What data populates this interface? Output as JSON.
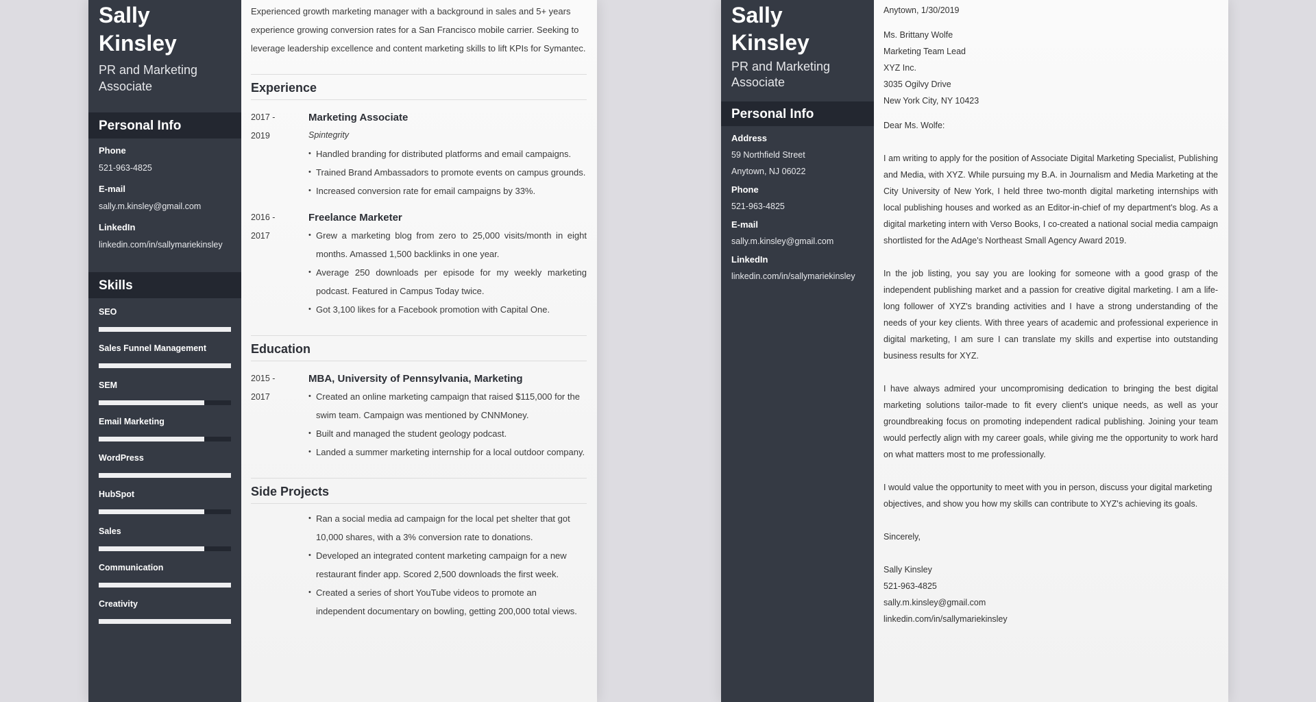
{
  "resume": {
    "sidebar": {
      "name_first": "Sally",
      "name_last": "Kinsley",
      "title": "PR and Marketing Associate",
      "personal_info_heading": "Personal Info",
      "personal_info": [
        {
          "label": "Phone",
          "value": "521-963-4825"
        },
        {
          "label": "E-mail",
          "value": "sally.m.kinsley@gmail.com"
        },
        {
          "label": "LinkedIn",
          "value": "linkedin.com/in/sallymariekinsley"
        }
      ],
      "skills_heading": "Skills",
      "skills": [
        {
          "name": "SEO",
          "level": 1.0
        },
        {
          "name": "Sales Funnel Management",
          "level": 1.0
        },
        {
          "name": "SEM",
          "level": 0.8
        },
        {
          "name": "Email Marketing",
          "level": 0.8
        },
        {
          "name": "WordPress",
          "level": 1.0
        },
        {
          "name": "HubSpot",
          "level": 0.8
        },
        {
          "name": "Sales",
          "level": 0.8
        },
        {
          "name": "Communication",
          "level": 1.0
        },
        {
          "name": "Creativity",
          "level": 1.0
        }
      ]
    },
    "summary": "Experienced growth marketing manager with a background in sales and 5+ years experience growing conversion rates for a San Francisco mobile carrier. Seeking to leverage leadership excellence and content marketing skills to lift KPIs for Symantec.",
    "experience": {
      "heading": "Experience",
      "entries": [
        {
          "date_start": "2017 -",
          "date_end": "2019",
          "title": "Marketing Associate",
          "company": "Spintegrity",
          "bullets": [
            "Handled branding for distributed platforms and email campaigns.",
            "Trained Brand Ambassadors to promote events on campus grounds.",
            "Increased conversion rate for email campaigns by 33%."
          ]
        },
        {
          "date_start": "2016 -",
          "date_end": "2017",
          "title": "Freelance Marketer",
          "bullets": [
            "Grew a marketing blog from zero to 25,000 visits/month in eight months. Amassed 1,500 backlinks in one year.",
            "Average 250 downloads per episode for my weekly marketing podcast. Featured in Campus Today twice.",
            "Got 3,100 likes for a Facebook promotion with Capital One."
          ]
        }
      ]
    },
    "education": {
      "heading": "Education",
      "entries": [
        {
          "date_start": "2015 -",
          "date_end": "2017",
          "title": "MBA, University of Pennsylvania, Marketing",
          "bullets": [
            "Created an online marketing campaign that raised $115,000 for the swim team. Campaign was mentioned by CNNMoney.",
            "Built and managed the student geology podcast.",
            "Landed a summer marketing internship for a local outdoor company."
          ]
        }
      ]
    },
    "side_projects": {
      "heading": "Side Projects",
      "bullets": [
        "Ran a social media ad campaign for the local pet shelter that got 10,000 shares, with a 3% conversion rate to donations.",
        "Developed an integrated content marketing campaign for a new restaurant finder app. Scored 2,500 downloads the first week.",
        "Created a series of short YouTube videos to promote an independent documentary on bowling, getting 200,000 total views."
      ]
    }
  },
  "cover_letter": {
    "sidebar": {
      "name_first": "Sally",
      "name_last": "Kinsley",
      "title": "PR and Marketing Associate",
      "personal_info_heading": "Personal Info",
      "personal_info": [
        {
          "label": "Address",
          "values": [
            "59 Northfield Street",
            "Anytown, NJ 06022"
          ]
        },
        {
          "label": "Phone",
          "values": [
            "521-963-4825"
          ]
        },
        {
          "label": "E-mail",
          "values": [
            "sally.m.kinsley@gmail.com"
          ]
        },
        {
          "label": "LinkedIn",
          "values": [
            "linkedin.com/in/sallymariekinsley"
          ]
        }
      ]
    },
    "date_line": "Anytown, 1/30/2019",
    "recipient": [
      "Ms. Brittany Wolfe",
      "Marketing Team Lead",
      "XYZ Inc.",
      "3035 Ogilvy Drive",
      "New York City, NY 10423"
    ],
    "salutation": "Dear Ms. Wolfe:",
    "paragraphs": [
      "I am writing to apply for the position of Associate Digital Marketing Specialist, Publishing and Media, with XYZ. While pursuing my B.A. in Journalism and Media Marketing at the City University of New York, I held three two-month digital marketing internships with local publishing houses and worked as an Editor-in-chief of my department's blog. As a digital marketing intern with Verso Books, I co-created a national social media campaign shortlisted for the AdAge's Northeast Small Agency Award 2019.",
      "In the job listing, you say you are looking for someone with a good grasp of the independent publishing market and a passion for creative digital marketing. I am a life-long follower of XYZ's branding activities and I have a strong understanding of the needs of your key clients. With three years of academic and professional experience in digital marketing, I am sure I can translate my skills and expertise into outstanding business results for XYZ.",
      "I have always admired your uncompromising dedication to bringing the best digital marketing solutions tailor-made to fit every client's unique needs, as well as your groundbreaking focus on promoting independent radical publishing. Joining your team would perfectly align with my career goals, while giving me the opportunity to work hard on what matters most to me professionally.",
      "I would value the opportunity to meet with you in person, discuss your digital marketing objectives, and show you how my skills can contribute to XYZ's achieving its goals."
    ],
    "closing": "Sincerely,",
    "signature": [
      "Sally Kinsley",
      "521-963-4825",
      "sally.m.kinsley@gmail.com",
      "linkedin.com/in/sallymariekinsley"
    ]
  },
  "colors": {
    "background": "#dddce1",
    "sidebar": "#353a44",
    "sidebar_band": "#232730",
    "page": "#f6f6f6",
    "text": "#333333"
  }
}
